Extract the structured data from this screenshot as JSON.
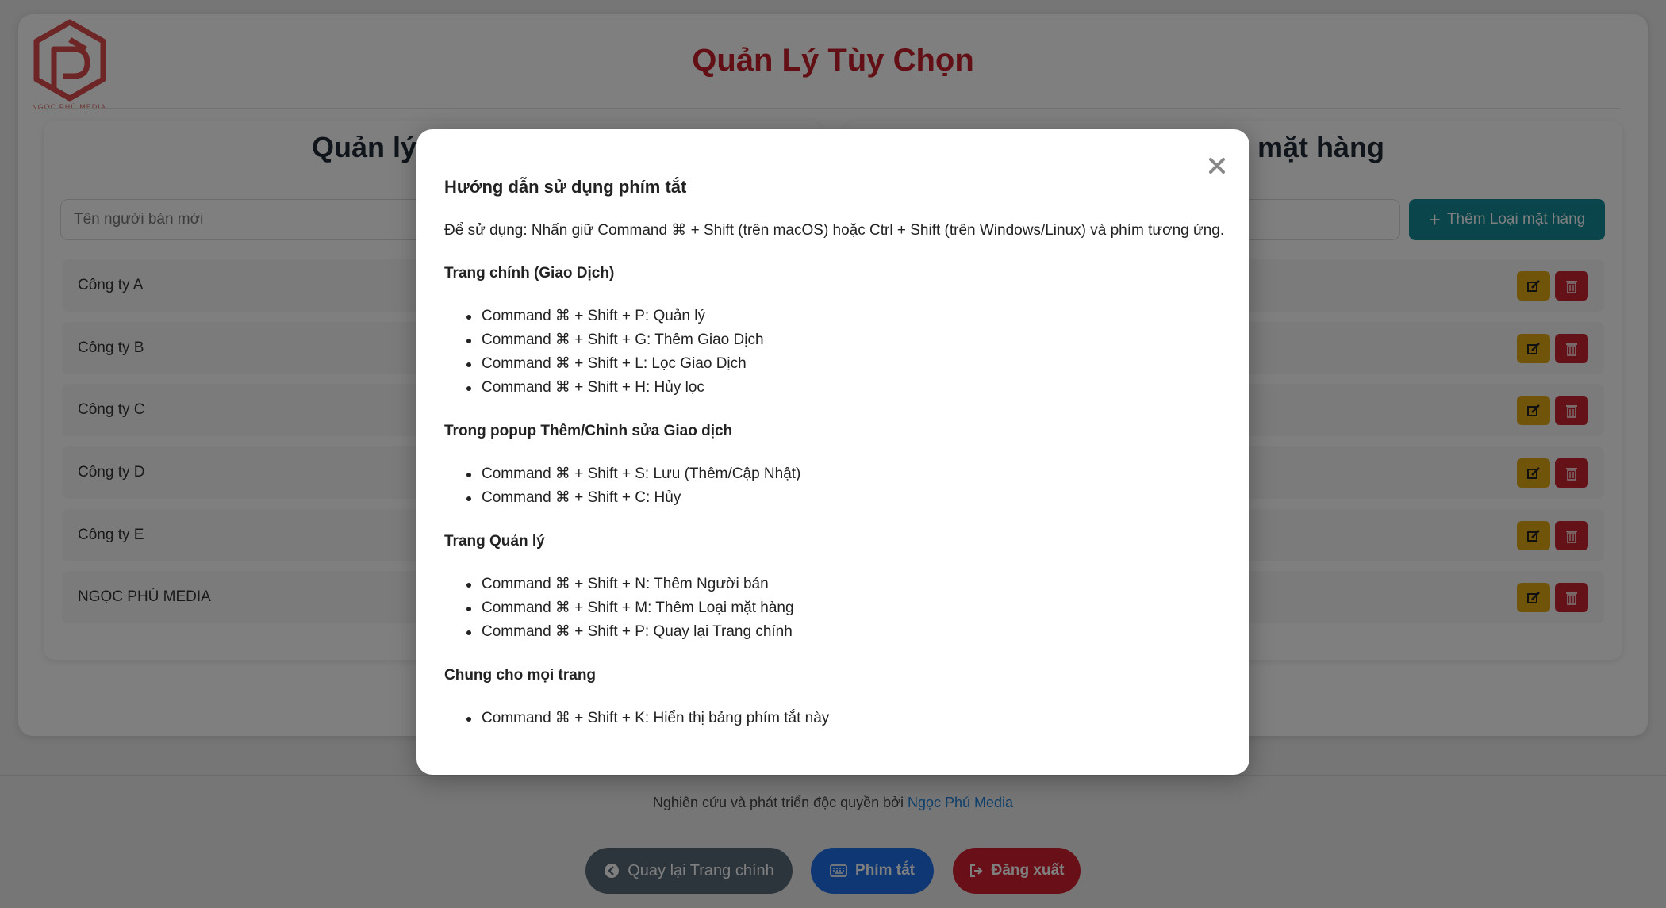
{
  "page": {
    "title": "Quản Lý Tùy Chọn",
    "logo_caption": "NGỌC PHÚ MEDIA"
  },
  "sellers_panel": {
    "title": "Quản lý",
    "input_placeholder": "Tên người bán mới",
    "items": [
      {
        "name": "Công ty A"
      },
      {
        "name": "Công ty B"
      },
      {
        "name": "Công ty C"
      },
      {
        "name": "Công ty D"
      },
      {
        "name": "Công ty E"
      },
      {
        "name": "NGỌC PHÚ MEDIA"
      }
    ]
  },
  "categories_panel": {
    "title": "mặt hàng",
    "add_button_label": "Thêm Loại mặt hàng",
    "row_count_visible": 6
  },
  "footer": {
    "text": "Nghiên cứu và phát triển độc quyền bởi",
    "link_text": "Ngọc Phú Media"
  },
  "bottom_buttons": {
    "back_label": "Quay lại Trang chính",
    "shortcuts_label": "Phím tắt",
    "logout_label": "Đăng xuất"
  },
  "modal": {
    "title": "Hướng dẫn sử dụng phím tắt",
    "intro": "Để sử dụng: Nhấn giữ Command ⌘ + Shift (trên macOS) hoặc Ctrl + Shift (trên Windows/Linux) và phím tương ứng.",
    "sections": [
      {
        "heading": "Trang chính (Giao Dịch)",
        "items": [
          "Command ⌘ + Shift + P: Quản lý",
          "Command ⌘ + Shift + G: Thêm Giao Dịch",
          "Command ⌘ + Shift + L: Lọc Giao Dịch",
          "Command ⌘ + Shift + H: Hủy lọc"
        ]
      },
      {
        "heading": "Trong popup Thêm/Chỉnh sửa Giao dịch",
        "items": [
          "Command ⌘ + Shift + S: Lưu (Thêm/Cập Nhật)",
          "Command ⌘ + Shift + C: Hủy"
        ]
      },
      {
        "heading": "Trang Quản lý",
        "items": [
          "Command ⌘ + Shift + N: Thêm Người bán",
          "Command ⌘ + Shift + M: Thêm Loại mặt hàng",
          "Command ⌘ + Shift + P: Quay lại Trang chính"
        ]
      },
      {
        "heading": "Chung cho mọi trang",
        "items": [
          "Command ⌘ + Shift + K: Hiển thị bảng phím tắt này"
        ]
      }
    ]
  },
  "colors": {
    "title_red": "#c4202b",
    "teal": "#138a96",
    "edit_yellow": "#e0a814",
    "delete_red": "#c9222f",
    "primary_blue": "#1f6fe6",
    "back_gray": "#5a6b78"
  }
}
